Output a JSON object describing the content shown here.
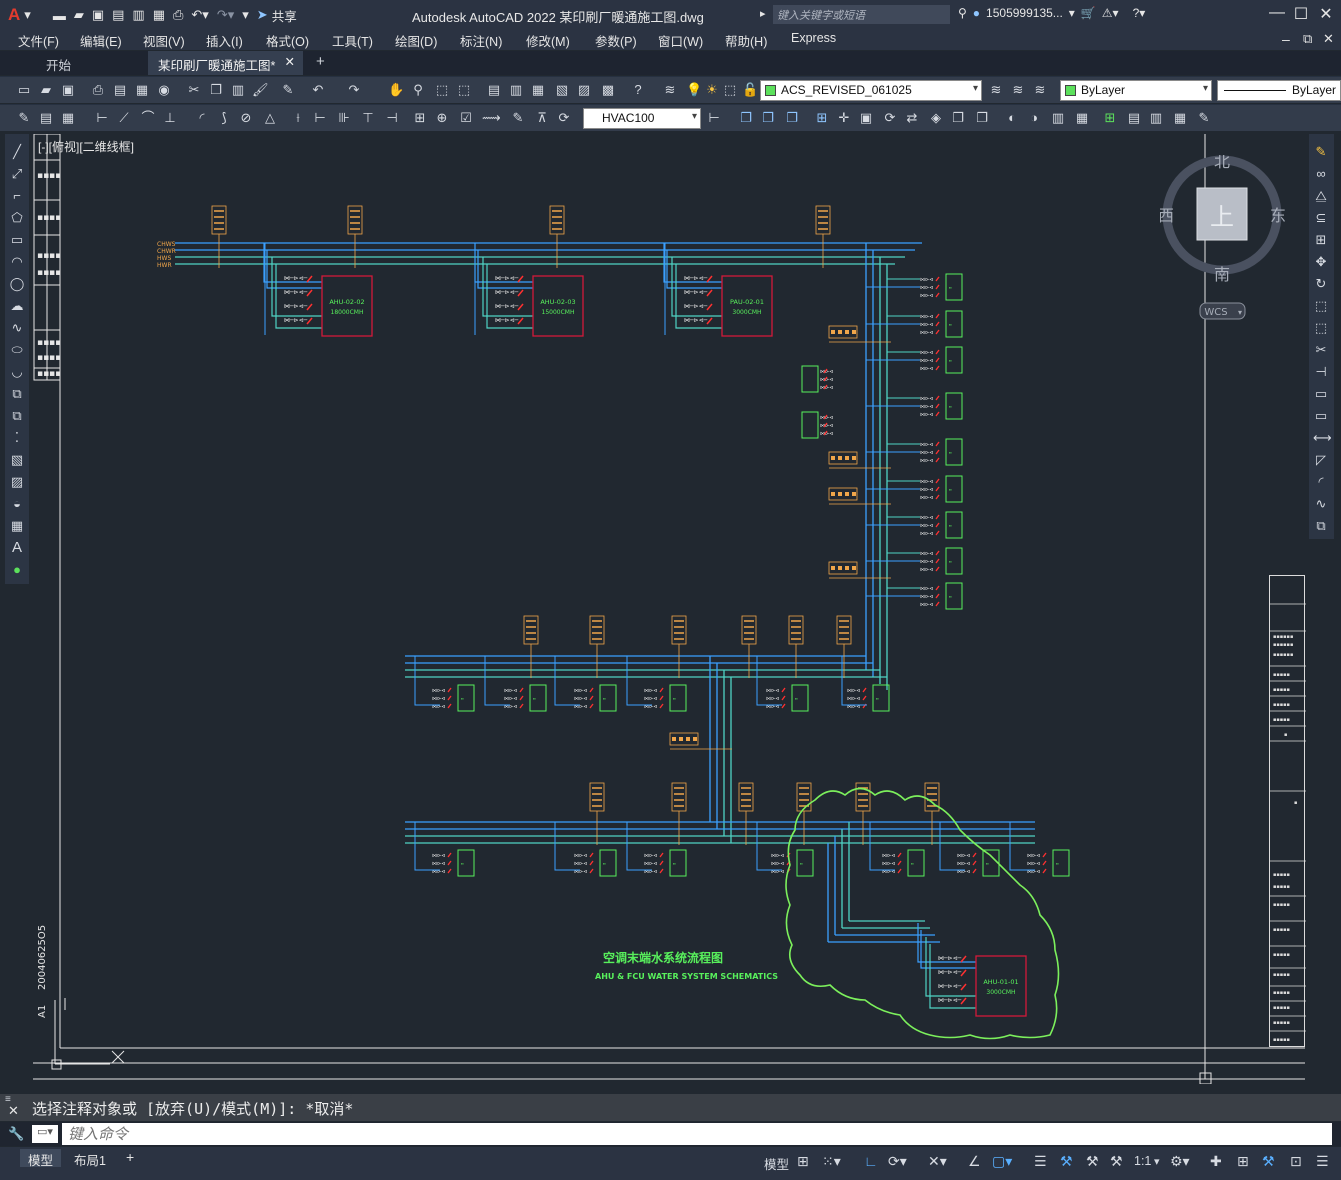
{
  "app": {
    "title": "Autodesk AutoCAD 2022    某印刷厂暖通施工图.dwg",
    "share_label": "共享",
    "search_placeholder": "键入关键字或短语",
    "user": "1505999135...",
    "accent_color": "#e23b2e"
  },
  "menu": [
    "文件(F)",
    "编辑(E)",
    "视图(V)",
    "插入(I)",
    "格式(O)",
    "工具(T)",
    "绘图(D)",
    "标注(N)",
    "修改(M)",
    "参数(P)",
    "窗口(W)",
    "帮助(H)",
    "Express"
  ],
  "tabs": [
    {
      "label": "开始",
      "active": false
    },
    {
      "label": "某印刷厂暖通施工图*",
      "active": true
    }
  ],
  "layer_combo": "ACS_REVISED_061025",
  "color_combo": "ByLayer",
  "linetype_combo": "ByLayer",
  "dimstyle_combo": "HVAC100",
  "viewport_label": "[-][俯视][二维线框]",
  "viewcube": {
    "north": "北",
    "south": "南",
    "east": "东",
    "west": "西",
    "face": "上",
    "wcs": "WCS"
  },
  "drawing": {
    "title_cn": "空调末端水系统流程图",
    "title_en": "AHU & FCU WATER SYSTEM SCHEMATICS",
    "units": [
      {
        "name": "AHU-02-02",
        "flow": "18000CMH"
      },
      {
        "name": "AHU-02-03",
        "flow": "15000CMH"
      },
      {
        "name": "PAU-02-01",
        "flow": "3000CMH"
      },
      {
        "name": "AHU-01-01",
        "flow": "3000CMH"
      }
    ],
    "side_text_1": "20040625O5",
    "side_text_2": "A1",
    "pipe_labels": [
      "CHWS",
      "CHWR",
      "HWS",
      "HWR"
    ]
  },
  "command": {
    "history": "选择注释对象或 [放弃(U)/模式(M)]: *取消*",
    "placeholder": "键入命令"
  },
  "layouts": [
    {
      "label": "模型",
      "active": true
    },
    {
      "label": "布局1",
      "active": false
    }
  ],
  "status": {
    "model": "模型",
    "scale": "1:1"
  }
}
